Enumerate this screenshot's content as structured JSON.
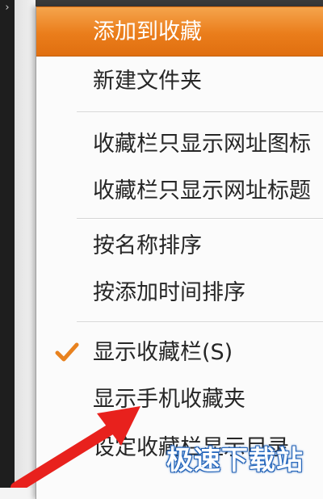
{
  "menu": {
    "items": [
      {
        "label": "添加到收藏"
      },
      {
        "label": "新建文件夹"
      },
      {
        "label": "收藏栏只显示网址图标"
      },
      {
        "label": "收藏栏只显示网址标题"
      },
      {
        "label": "按名称排序"
      },
      {
        "label": "按添加时间排序"
      },
      {
        "label": "显示收藏栏(S)"
      },
      {
        "label": "显示手机收藏夹"
      },
      {
        "label": "设定收藏栏显示目录"
      }
    ]
  },
  "watermark": "极速下载站",
  "colors": {
    "highlight": "#ea7d1b",
    "check": "#e8821f",
    "arrow": "#e8211d",
    "watermark_outline": "#2d6fc4"
  },
  "icons": {
    "check": "checkmark-icon",
    "annotation": "red-arrow"
  }
}
